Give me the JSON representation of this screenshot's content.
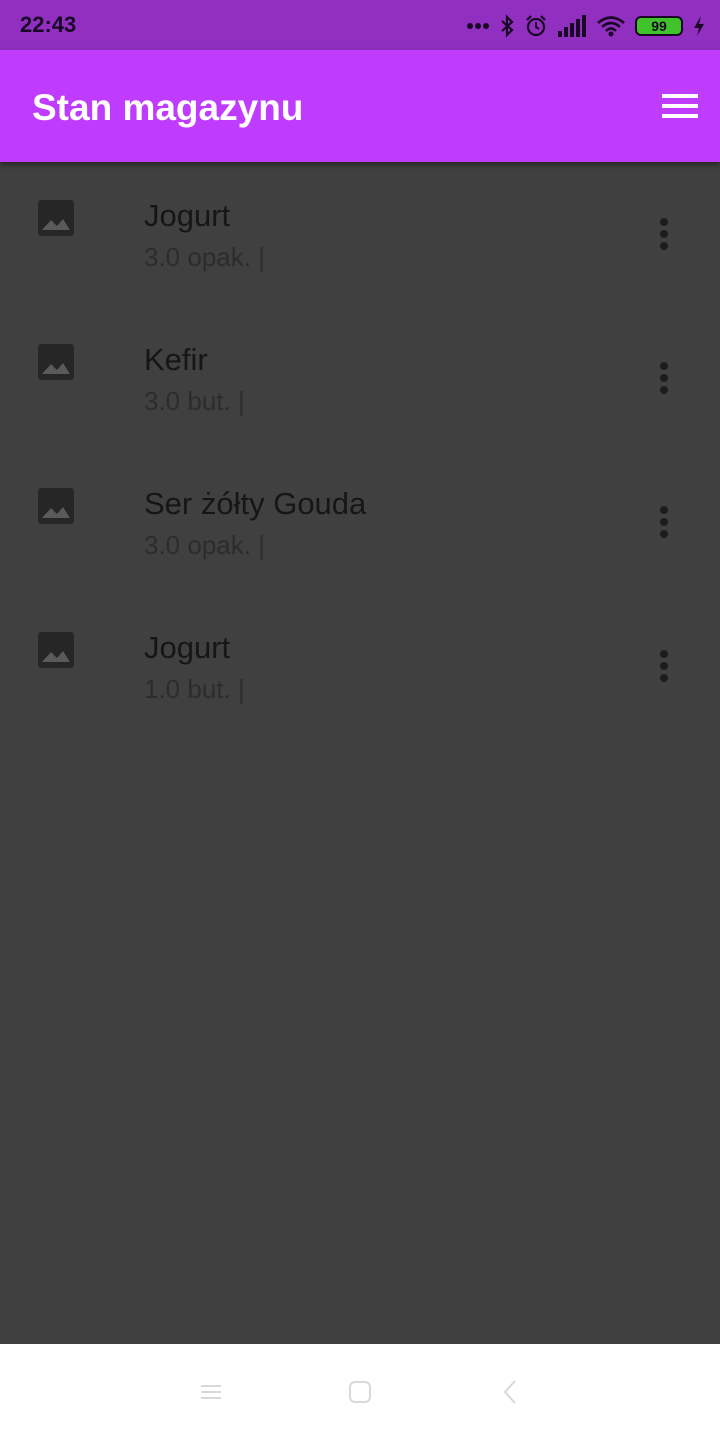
{
  "status_bar": {
    "time": "22:43",
    "battery_level": "99",
    "icons": [
      "more-dots-icon",
      "bluetooth-icon",
      "alarm-icon",
      "signal-icon",
      "wifi-icon",
      "battery-icon",
      "charging-icon"
    ]
  },
  "app_bar": {
    "title": "Stan magazynu",
    "menu_icon": "hamburger-menu-icon"
  },
  "items": [
    {
      "name": "Jogurt",
      "quantity": "3.0 opak. |",
      "thumb_icon": "image-icon",
      "more_icon": "more-vert-icon"
    },
    {
      "name": "Kefir",
      "quantity": "3.0 but. |",
      "thumb_icon": "image-icon",
      "more_icon": "more-vert-icon"
    },
    {
      "name": "Ser żółty Gouda",
      "quantity": "3.0 opak. |",
      "thumb_icon": "image-icon",
      "more_icon": "more-vert-icon"
    },
    {
      "name": "Jogurt",
      "quantity": "1.0 but. |",
      "thumb_icon": "image-icon",
      "more_icon": "more-vert-icon"
    }
  ],
  "nav_bar": {
    "icons": [
      "recents-icon",
      "home-icon",
      "back-icon"
    ]
  },
  "colors": {
    "status_bar": "#9130c0",
    "app_bar": "#bf3cff",
    "background": "#404040",
    "nav_bar": "#ffffff"
  }
}
